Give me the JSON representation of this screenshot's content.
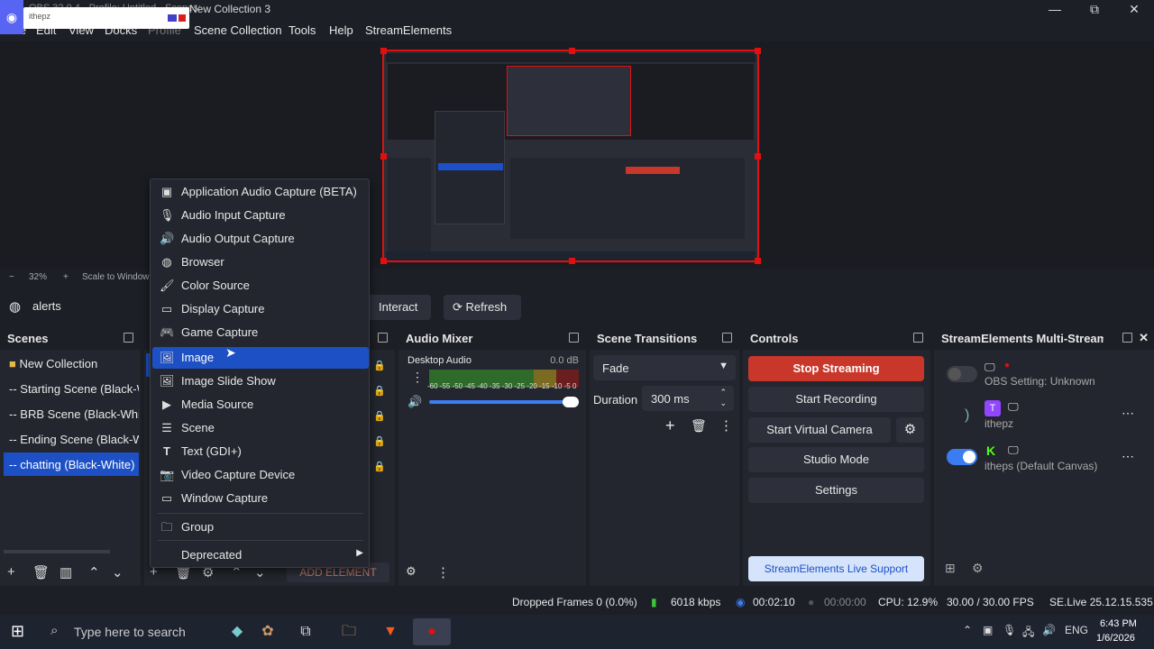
{
  "titlebar": {
    "faded_title": "OBS 32.0.4 - Profile: Untitled - Scenes:",
    "title": "New Collection 3",
    "min": "—",
    "max": "⧉",
    "close": "✕"
  },
  "discord_overlay": {
    "logo": "◉",
    "user": "ithepz"
  },
  "menu": {
    "file": "File",
    "edit": "Edit",
    "view": "View",
    "docks": "Docks",
    "profile": "Profile",
    "scene_collection": "Scene Collection",
    "tools": "Tools",
    "help": "Help",
    "streamelements": "StreamElements"
  },
  "zoom": {
    "minus": "−",
    "percent": "32%",
    "plus": "+",
    "scale": "Scale to Window"
  },
  "source_bar": {
    "source_name": "alerts",
    "interact": "Interact",
    "refresh": "Refresh"
  },
  "scenes": {
    "title": "Scenes",
    "items": [
      {
        "label": "New Collection"
      },
      {
        "label": "-- Starting Scene (Black-White)"
      },
      {
        "label": "-- BRB Scene (Black-White)"
      },
      {
        "label": "-- Ending Scene (Black-White)"
      },
      {
        "label": "-- chatting (Black-White)"
      }
    ]
  },
  "context_menu": {
    "items": [
      {
        "label": "Application Audio Capture (BETA)",
        "icon": "app-audio-icon"
      },
      {
        "label": "Audio Input Capture",
        "icon": "microphone-icon"
      },
      {
        "label": "Audio Output Capture",
        "icon": "speaker-icon"
      },
      {
        "label": "Browser",
        "icon": "globe-icon"
      },
      {
        "label": "Color Source",
        "icon": "brush-icon"
      },
      {
        "label": "Display Capture",
        "icon": "monitor-icon"
      },
      {
        "label": "Game Capture",
        "icon": "gamepad-icon"
      },
      {
        "label": "Image",
        "icon": "image-icon"
      },
      {
        "label": "Image Slide Show",
        "icon": "slideshow-icon"
      },
      {
        "label": "Media Source",
        "icon": "play-icon"
      },
      {
        "label": "Scene",
        "icon": "list-icon"
      },
      {
        "label": "Text (GDI+)",
        "icon": "text-icon"
      },
      {
        "label": "Video Capture Device",
        "icon": "camera-icon"
      },
      {
        "label": "Window Capture",
        "icon": "window-icon"
      },
      {
        "label": "Group",
        "icon": "folder-icon"
      },
      {
        "label": "Deprecated",
        "icon": ""
      }
    ],
    "add_element": "ADD ELEMENT"
  },
  "audio_mixer": {
    "title": "Audio Mixer",
    "channel": "Desktop Audio",
    "db": "0.0 dB",
    "scale": "-60 -55 -50 -45 -40 -35 -30 -25 -20 -15 -10 -5 0"
  },
  "transitions": {
    "title": "Scene Transitions",
    "selected": "Fade",
    "duration_label": "Duration",
    "duration_value": "300 ms"
  },
  "controls": {
    "title": "Controls",
    "stop_streaming": "Stop Streaming",
    "start_recording": "Start Recording",
    "start_virtual_camera": "Start Virtual Camera",
    "studio_mode": "Studio Mode",
    "settings": "Settings",
    "support": "StreamElements Live Support"
  },
  "multistream": {
    "title": "StreamElements Multi-Stream",
    "rows": [
      {
        "label": "OBS Setting: Unknown",
        "toggle": "off"
      },
      {
        "label": "ithepz",
        "toggle": "none"
      },
      {
        "label": "itheps (Default Canvas)",
        "toggle": "on"
      }
    ]
  },
  "status": {
    "dropped": "Dropped Frames 0 (0.0%)",
    "kbps": "6018 kbps",
    "live_time": "00:02:10",
    "rec_time": "00:00:00",
    "cpu": "CPU: 12.9%",
    "fps": "30.00 / 30.00 FPS",
    "version": "SE.Live 25.12.15.535"
  },
  "taskbar": {
    "search_placeholder": "Type here to search",
    "lang": "ENG",
    "time": "6:43 PM",
    "date": "1/6/2026"
  },
  "colors": {
    "accent": "#1d50c4",
    "stop": "#c8372a",
    "selection_border": "#e01010"
  }
}
